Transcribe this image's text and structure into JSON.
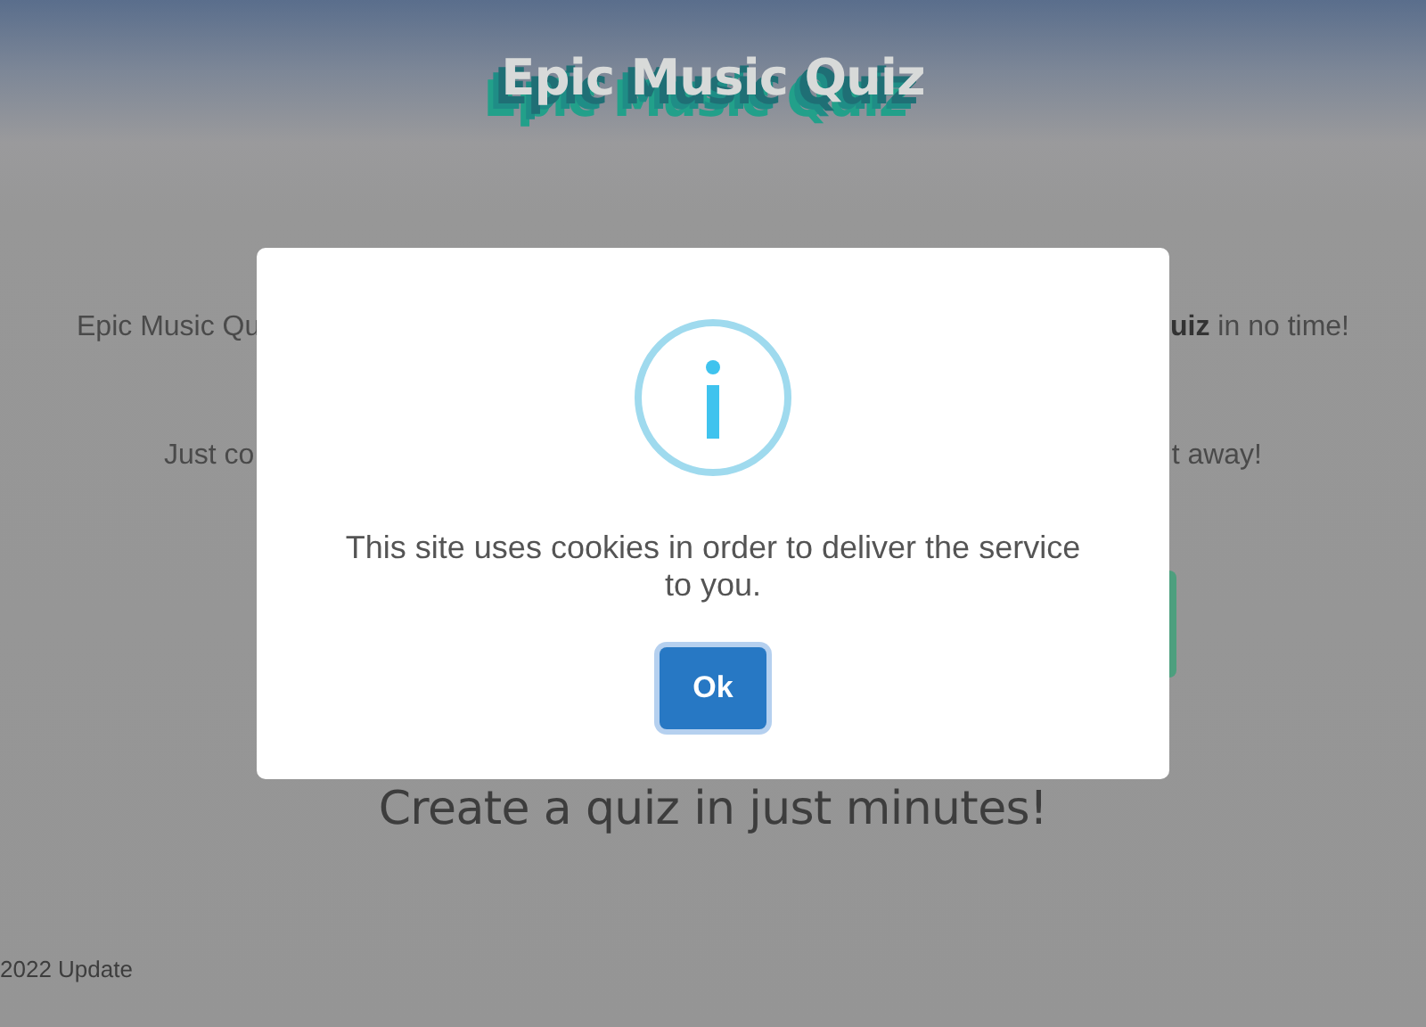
{
  "page": {
    "title": "Epic Music Quiz",
    "intro_left": "Epic Music Qu",
    "intro_right": "**uiz** in no time!",
    "copy_left": "Just co",
    "copy_right": "t away!",
    "heading": "Create a quiz in just minutes!",
    "footer": "2022 Update"
  },
  "dialog": {
    "message": "This site uses cookies in order to deliver the service to you.",
    "button": "Ok"
  }
}
